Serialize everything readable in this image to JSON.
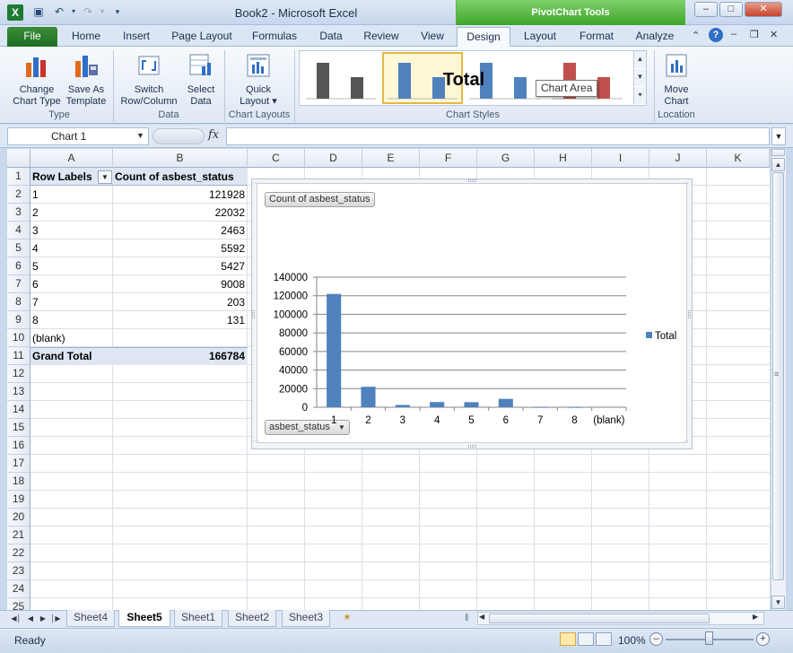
{
  "window": {
    "title": "Book2 - Microsoft Excel",
    "context_title": "PivotChart Tools"
  },
  "ribbon": {
    "tabs": [
      "File",
      "Home",
      "Insert",
      "Page Layout",
      "Formulas",
      "Data",
      "Review",
      "View",
      "Design",
      "Layout",
      "Format",
      "Analyze"
    ],
    "active_tab": "Design",
    "groups": {
      "type": {
        "label": "Type",
        "change_chart_type": "Change Chart Type",
        "change_l1": "Change",
        "change_l2": "Chart Type",
        "save_l1": "Save As",
        "save_l2": "Template"
      },
      "data": {
        "label": "Data",
        "switch_l1": "Switch",
        "switch_l2": "Row/Column",
        "select_l1": "Select",
        "select_l2": "Data"
      },
      "chart_layouts": {
        "label": "Chart Layouts",
        "quick_l1": "Quick",
        "quick_l2": "Layout ▾"
      },
      "chart_styles": {
        "label": "Chart Styles"
      },
      "location": {
        "label": "Location",
        "move_l1": "Move",
        "move_l2": "Chart"
      }
    },
    "style_colors": [
      "#555555",
      "#4f81bd",
      "#4f81bd",
      "#c0504d"
    ]
  },
  "formula_bar": {
    "name_box": "Chart 1",
    "fx": "fx",
    "formula": ""
  },
  "sheet": {
    "columns": [
      "A",
      "B",
      "C",
      "D",
      "E",
      "F",
      "G",
      "H",
      "I",
      "J",
      "K"
    ],
    "rows": [
      "1",
      "2",
      "3",
      "4",
      "5",
      "6",
      "7",
      "8",
      "9",
      "10",
      "11",
      "12",
      "13",
      "14",
      "15",
      "16",
      "17",
      "18",
      "19",
      "20",
      "21",
      "22",
      "23",
      "24",
      "25"
    ],
    "pivot": {
      "header_a": "Row Labels",
      "header_b": "Count of asbest_status",
      "rows": [
        {
          "label": "1",
          "value": "121928"
        },
        {
          "label": "2",
          "value": "22032"
        },
        {
          "label": "3",
          "value": "2463"
        },
        {
          "label": "4",
          "value": "5592"
        },
        {
          "label": "5",
          "value": "5427"
        },
        {
          "label": "6",
          "value": "9008"
        },
        {
          "label": "7",
          "value": "203"
        },
        {
          "label": "8",
          "value": "131"
        },
        {
          "label": "(blank)",
          "value": ""
        }
      ],
      "total_label": "Grand Total",
      "total_value": "166784"
    }
  },
  "chart": {
    "value_field_button": "Count of asbest_status",
    "axis_field_button": "asbest_status",
    "tooltip": "Chart Area",
    "legend_marker_color": "#4f81bd"
  },
  "chart_data": {
    "type": "bar",
    "title": "Total",
    "categories": [
      "1",
      "2",
      "3",
      "4",
      "5",
      "6",
      "7",
      "8",
      "(blank)"
    ],
    "series": [
      {
        "name": "Total",
        "values": [
          121928,
          22032,
          2463,
          5592,
          5427,
          9008,
          203,
          131,
          0
        ],
        "color": "#4f81bd"
      }
    ],
    "yticks": [
      "0",
      "20000",
      "40000",
      "60000",
      "80000",
      "100000",
      "120000",
      "140000"
    ],
    "ylim": [
      0,
      140000
    ],
    "grid": true,
    "legend": "right"
  },
  "tabs_bar": {
    "sheets": [
      "Sheet4",
      "Sheet5",
      "Sheet1",
      "Sheet2",
      "Sheet3"
    ],
    "active": "Sheet5"
  },
  "status": {
    "text": "Ready",
    "zoom": "100%"
  }
}
